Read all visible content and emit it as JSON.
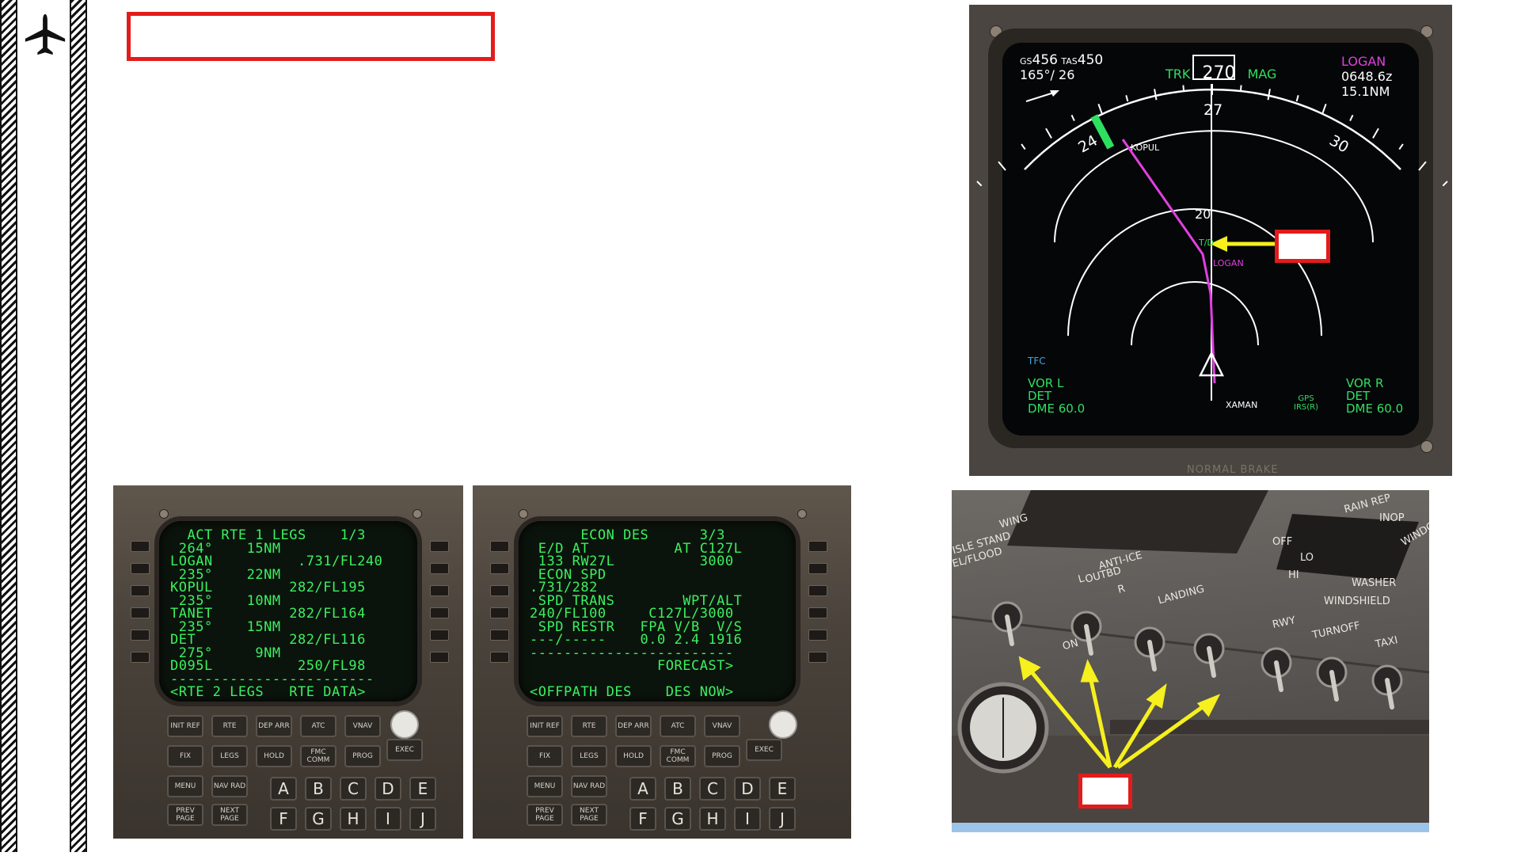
{
  "sidebar": {
    "icon": "airplane-icon"
  },
  "title_box": {
    "text": ""
  },
  "fmc_left": {
    "lines": [
      "  ACT RTE 1 LEGS    1/3",
      " 264°    15NM",
      "LOGAN          .731/FL240",
      " 235°    22NM",
      "KOPUL         282/FL195",
      " 235°    10NM",
      "TANET         282/FL164",
      " 235°    15NM",
      "DET           282/FL116",
      " 275°     9NM",
      "D095L          250/FL98",
      "------------------------",
      "<RTE 2 LEGS   RTE DATA>"
    ],
    "keys_row1": [
      "INIT REF",
      "RTE",
      "DEP ARR",
      "ATC",
      "VNAV"
    ],
    "keys_row2": [
      "FIX",
      "LEGS",
      "HOLD",
      "FMC COMM",
      "PROG"
    ],
    "keys_row3": [
      "MENU",
      "NAV RAD"
    ],
    "keys_row4": [
      "PREV PAGE",
      "NEXT PAGE"
    ],
    "exec": "EXEC",
    "brt": "BRT",
    "alpha_row1": [
      "A",
      "B",
      "C",
      "D",
      "E"
    ],
    "alpha_row2": [
      "F",
      "G",
      "H",
      "I",
      "J"
    ]
  },
  "fmc_right": {
    "lines": [
      "      ECON DES      3/3",
      " E/D AT          AT C127L",
      " 133 RW27L          3000",
      " ECON SPD",
      ".731/282",
      " SPD TRANS        WPT/ALT",
      "240/FL100     C127L/3000",
      " SPD RESTR   FPA V/B  V/S",
      "---/-----    0.0 2.4 1916",
      "------------------------",
      "               FORECAST>",
      "",
      "<OFFPATH DES    DES NOW>"
    ],
    "keys_row1": [
      "INIT REF",
      "RTE",
      "DEP ARR",
      "ATC",
      "VNAV"
    ],
    "keys_row2": [
      "FIX",
      "LEGS",
      "HOLD",
      "FMC COMM",
      "PROG"
    ],
    "keys_row3": [
      "MENU",
      "NAV RAD"
    ],
    "keys_row4": [
      "PREV PAGE",
      "NEXT PAGE"
    ],
    "exec": "EXEC",
    "brt": "BRT",
    "alpha_row1": [
      "A",
      "B",
      "C",
      "D",
      "E"
    ],
    "alpha_row2": [
      "F",
      "G",
      "H",
      "I",
      "J"
    ]
  },
  "nd": {
    "gs_label": "GS",
    "gs": "456",
    "tas_label": "TAS",
    "tas": "450",
    "wind": "165°/ 26",
    "trk_label": "TRK",
    "heading": "270",
    "mag_label": "MAG",
    "waypoint": "LOGAN",
    "eta": "0648.6z",
    "dist": "15.1NM",
    "compass": [
      "24",
      "27",
      "30"
    ],
    "range_label": "20",
    "waypoints": [
      "KOPUL",
      "T/D",
      "LOGAN",
      "XAMAN"
    ],
    "tfc": "TFC",
    "vor_l": [
      "VOR L",
      "DET",
      "DME 60.0"
    ],
    "vor_r": [
      "VOR R",
      "DET",
      "DME 60.0"
    ],
    "gps": [
      "GPS",
      "IRS(R)"
    ],
    "bezel_text": "NORMAL BRAKE",
    "callout_box": ""
  },
  "overhead": {
    "labels": [
      "WING",
      "ANTI-ICE",
      "ISLE STAND",
      "EL/FLOOD",
      "OUTBD",
      "LANDING",
      "RWY",
      "TURNOFF",
      "TAXI",
      "OFF",
      "LO",
      "HI",
      "WASHER",
      "WINDSHIELD",
      "RAIN REP",
      "INOP",
      "WINDOW",
      "ON",
      "L",
      "R"
    ],
    "callout_box": ""
  },
  "colors": {
    "callout_red": "#e41b1b",
    "arrow_yellow": "#f5f01e",
    "fmc_green": "#3cf060",
    "nd_magenta": "#e040e0"
  }
}
